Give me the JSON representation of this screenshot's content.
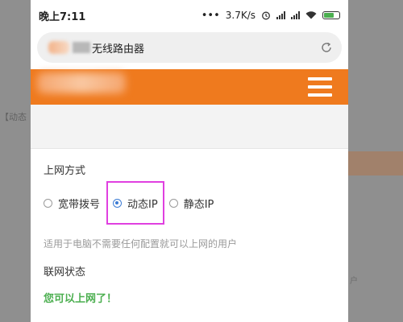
{
  "statusbar": {
    "time": "晚上7:11",
    "dots": "•••",
    "speed": "3.7K/s"
  },
  "browser": {
    "title": "无线路由器"
  },
  "background": {
    "left_text": "【动态",
    "right_hint": "户"
  },
  "connection": {
    "section_title": "上网方式",
    "options": [
      {
        "label": "宽带拨号",
        "selected": false
      },
      {
        "label": "动态IP",
        "selected": true
      },
      {
        "label": "静态IP",
        "selected": false
      }
    ],
    "description": "适用于电脑不需要任何配置就可以上网的用户"
  },
  "network_status": {
    "title": "联网状态",
    "message": "您可以上网了！"
  },
  "colors": {
    "header": "#ef7a1e",
    "highlight": "#e040e0",
    "success": "#4caf50",
    "radio": "#3b7bd4"
  }
}
